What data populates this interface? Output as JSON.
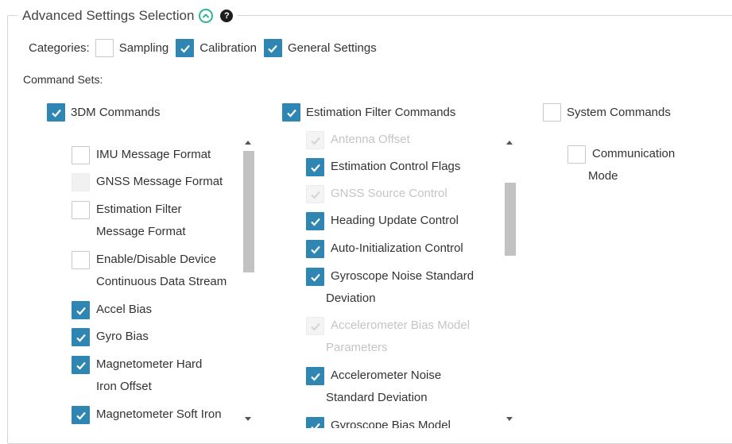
{
  "section": {
    "title": "Advanced Settings Selection",
    "help": "?"
  },
  "categories": {
    "label": "Categories:",
    "items": [
      {
        "label": "Sampling",
        "checked": false
      },
      {
        "label": "Calibration",
        "checked": true
      },
      {
        "label": "General Settings",
        "checked": true
      }
    ]
  },
  "command_sets": {
    "label": "Command Sets:",
    "groups": [
      {
        "label": "3DM Commands",
        "checked": true,
        "items": [
          {
            "l1": "IMU Message Format",
            "l2": "",
            "state": "unchecked"
          },
          {
            "l1": "GNSS Message Format",
            "l2": "",
            "state": "disabled"
          },
          {
            "l1": "Estimation Filter",
            "l2": "Message Format",
            "state": "unchecked"
          },
          {
            "l1": "Enable/Disable Device",
            "l2": "Continuous Data Stream",
            "state": "unchecked"
          },
          {
            "l1": "Accel Bias",
            "l2": "",
            "state": "checked"
          },
          {
            "l1": "Gyro Bias",
            "l2": "",
            "state": "checked"
          },
          {
            "l1": "Magnetometer Hard",
            "l2": "Iron Offset",
            "state": "checked"
          },
          {
            "l1": "Magnetometer Soft Iron",
            "l2": "",
            "state": "checked"
          }
        ]
      },
      {
        "label": "Estimation Filter Commands",
        "checked": true,
        "items": [
          {
            "l1": "Antenna Offset",
            "l2": "",
            "state": "checked-disabled"
          },
          {
            "l1": "Estimation Control Flags",
            "l2": "",
            "state": "checked"
          },
          {
            "l1": "GNSS Source Control",
            "l2": "",
            "state": "checked-disabled"
          },
          {
            "l1": "Heading Update Control",
            "l2": "",
            "state": "checked"
          },
          {
            "l1": "Auto-Initialization Control",
            "l2": "",
            "state": "checked"
          },
          {
            "l1": "Gyroscope Noise Standard",
            "l2": "Deviation",
            "state": "checked"
          },
          {
            "l1": "Accelerometer Bias Model",
            "l2": "Parameters",
            "state": "checked-disabled"
          },
          {
            "l1": "Accelerometer Noise",
            "l2": "Standard Deviation",
            "state": "checked"
          },
          {
            "l1": "Gyroscope Bias Model",
            "l2": "",
            "state": "checked"
          }
        ]
      },
      {
        "label": "System Commands",
        "checked": false,
        "items": [
          {
            "l1": "Communication",
            "l2": "Mode",
            "state": "unchecked"
          }
        ]
      }
    ]
  },
  "colors": {
    "accent": "#2f86b3",
    "collapse_icon": "#2eb39a",
    "border": "#d6d6d6",
    "scrollbar_thumb": "#c2c2c2"
  },
  "icons": {
    "collapse": "chevron-up-circle-icon",
    "help": "question-circle-icon",
    "check": "check-icon"
  }
}
